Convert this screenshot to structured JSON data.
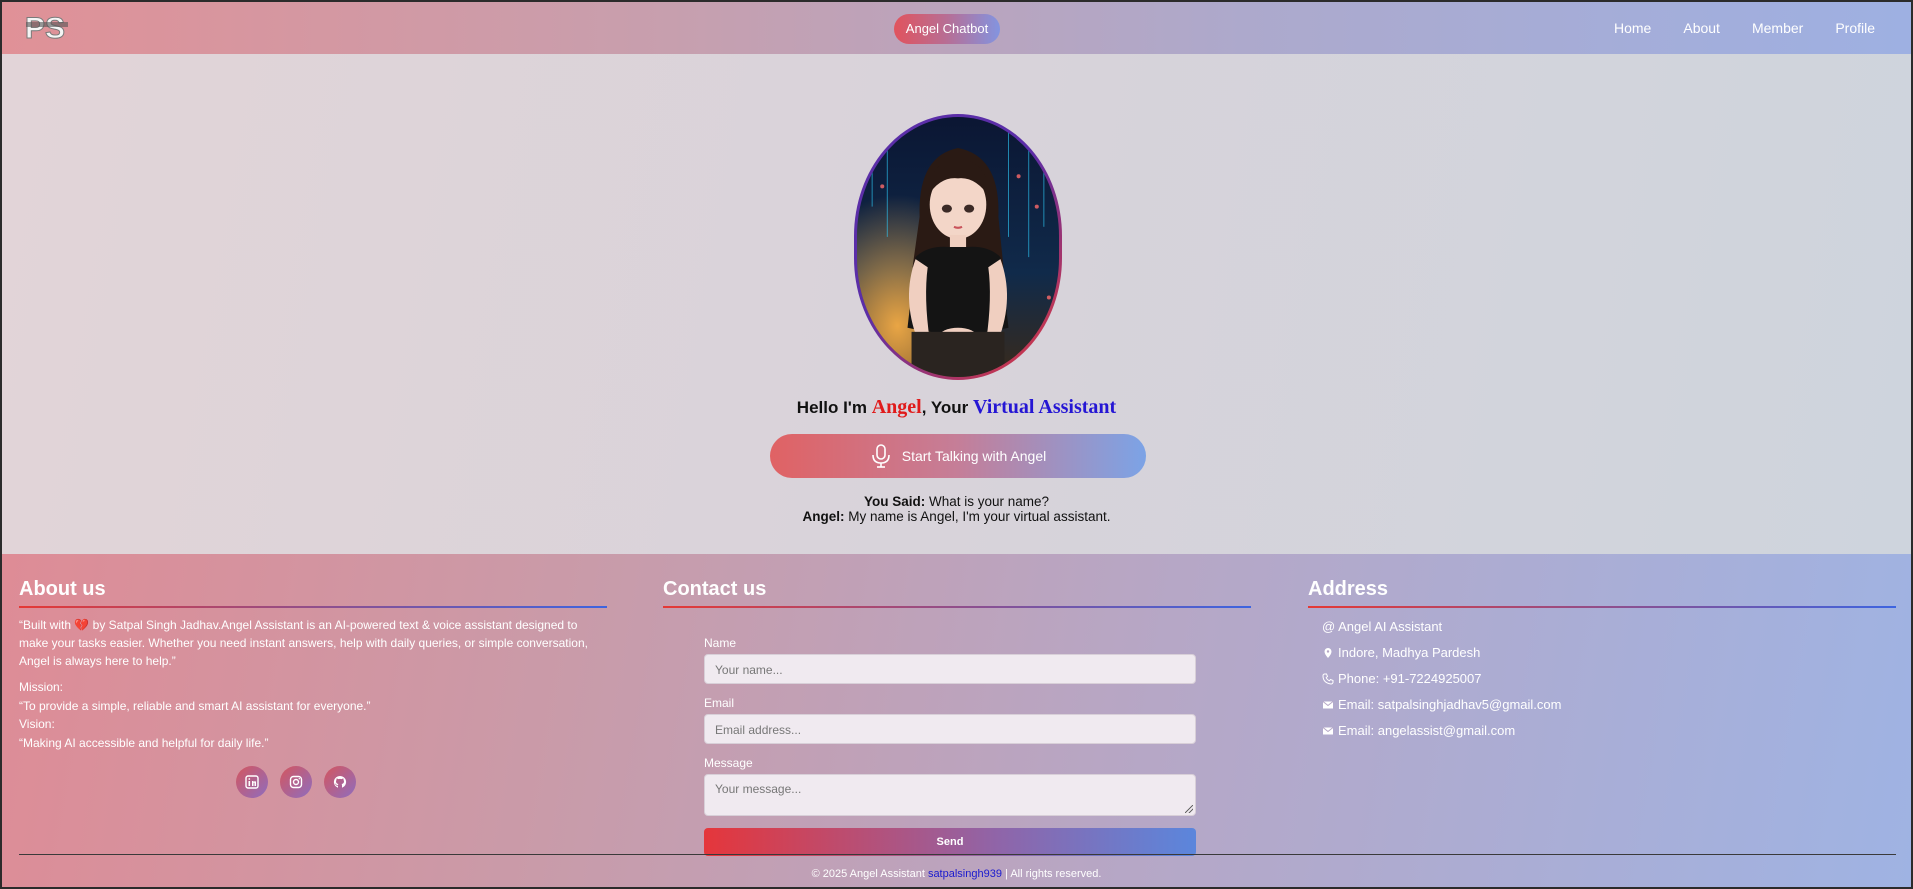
{
  "nav": {
    "logo_text": "PS",
    "brand_pill": "Angel Chatbot",
    "links": [
      "Home",
      "About",
      "Member",
      "Profile"
    ]
  },
  "hero": {
    "greeting_prefix": "Hello I'm ",
    "greeting_name": "Angel",
    "greeting_mid": ", Your ",
    "greeting_role": "Virtual Assistant",
    "talk_button": "Start Talking with Angel",
    "you_said_label": "You Said:",
    "you_said_text": " What is your name?",
    "angel_label": "Angel:",
    "angel_text": " My name is Angel, I'm your virtual assistant."
  },
  "footer": {
    "about": {
      "title": "About us",
      "body_pre": "“Built with ",
      "body_heart": "💔",
      "body_post": " by Satpal Singh Jadhav.Angel Assistant is an AI-powered text & voice assistant designed to make your tasks easier. Whether you need instant answers, help with daily queries, or simple conversation, Angel is always here to help.”",
      "mission_label": "Mission:",
      "mission_text": "“To provide a simple, reliable and smart AI assistant for everyone.”",
      "vision_label": "Vision:",
      "vision_text": "“Making AI accessible and helpful for daily life.”",
      "socials": [
        "linkedin-icon",
        "instagram-icon",
        "github-icon"
      ]
    },
    "contact": {
      "title": "Contact us",
      "name_label": "Name",
      "name_placeholder": "Your name...",
      "email_label": "Email",
      "email_placeholder": "Email address...",
      "message_label": "Message",
      "message_placeholder": "Your message...",
      "send_label": "Send"
    },
    "address": {
      "title": "Address",
      "items": [
        {
          "icon": "at-icon",
          "text": "@ Angel AI Assistant"
        },
        {
          "icon": "location-pin-icon",
          "text": "Indore, Madhya Pardesh"
        },
        {
          "icon": "phone-icon",
          "text": "Phone: +91-7224925007"
        },
        {
          "icon": "mail-icon",
          "text": "Email: satpalsinghjadhav5@gmail.com"
        },
        {
          "icon": "mail-icon",
          "text": "Email: angelassist@gmail.com"
        }
      ]
    },
    "copyright_pre": "© 2025 Angel Assistant ",
    "copyright_link": "satpalsingh939",
    "copyright_post": " | All rights reserved."
  },
  "colors": {
    "accent_red": "#e01b1b",
    "accent_blue": "#2516d4"
  }
}
